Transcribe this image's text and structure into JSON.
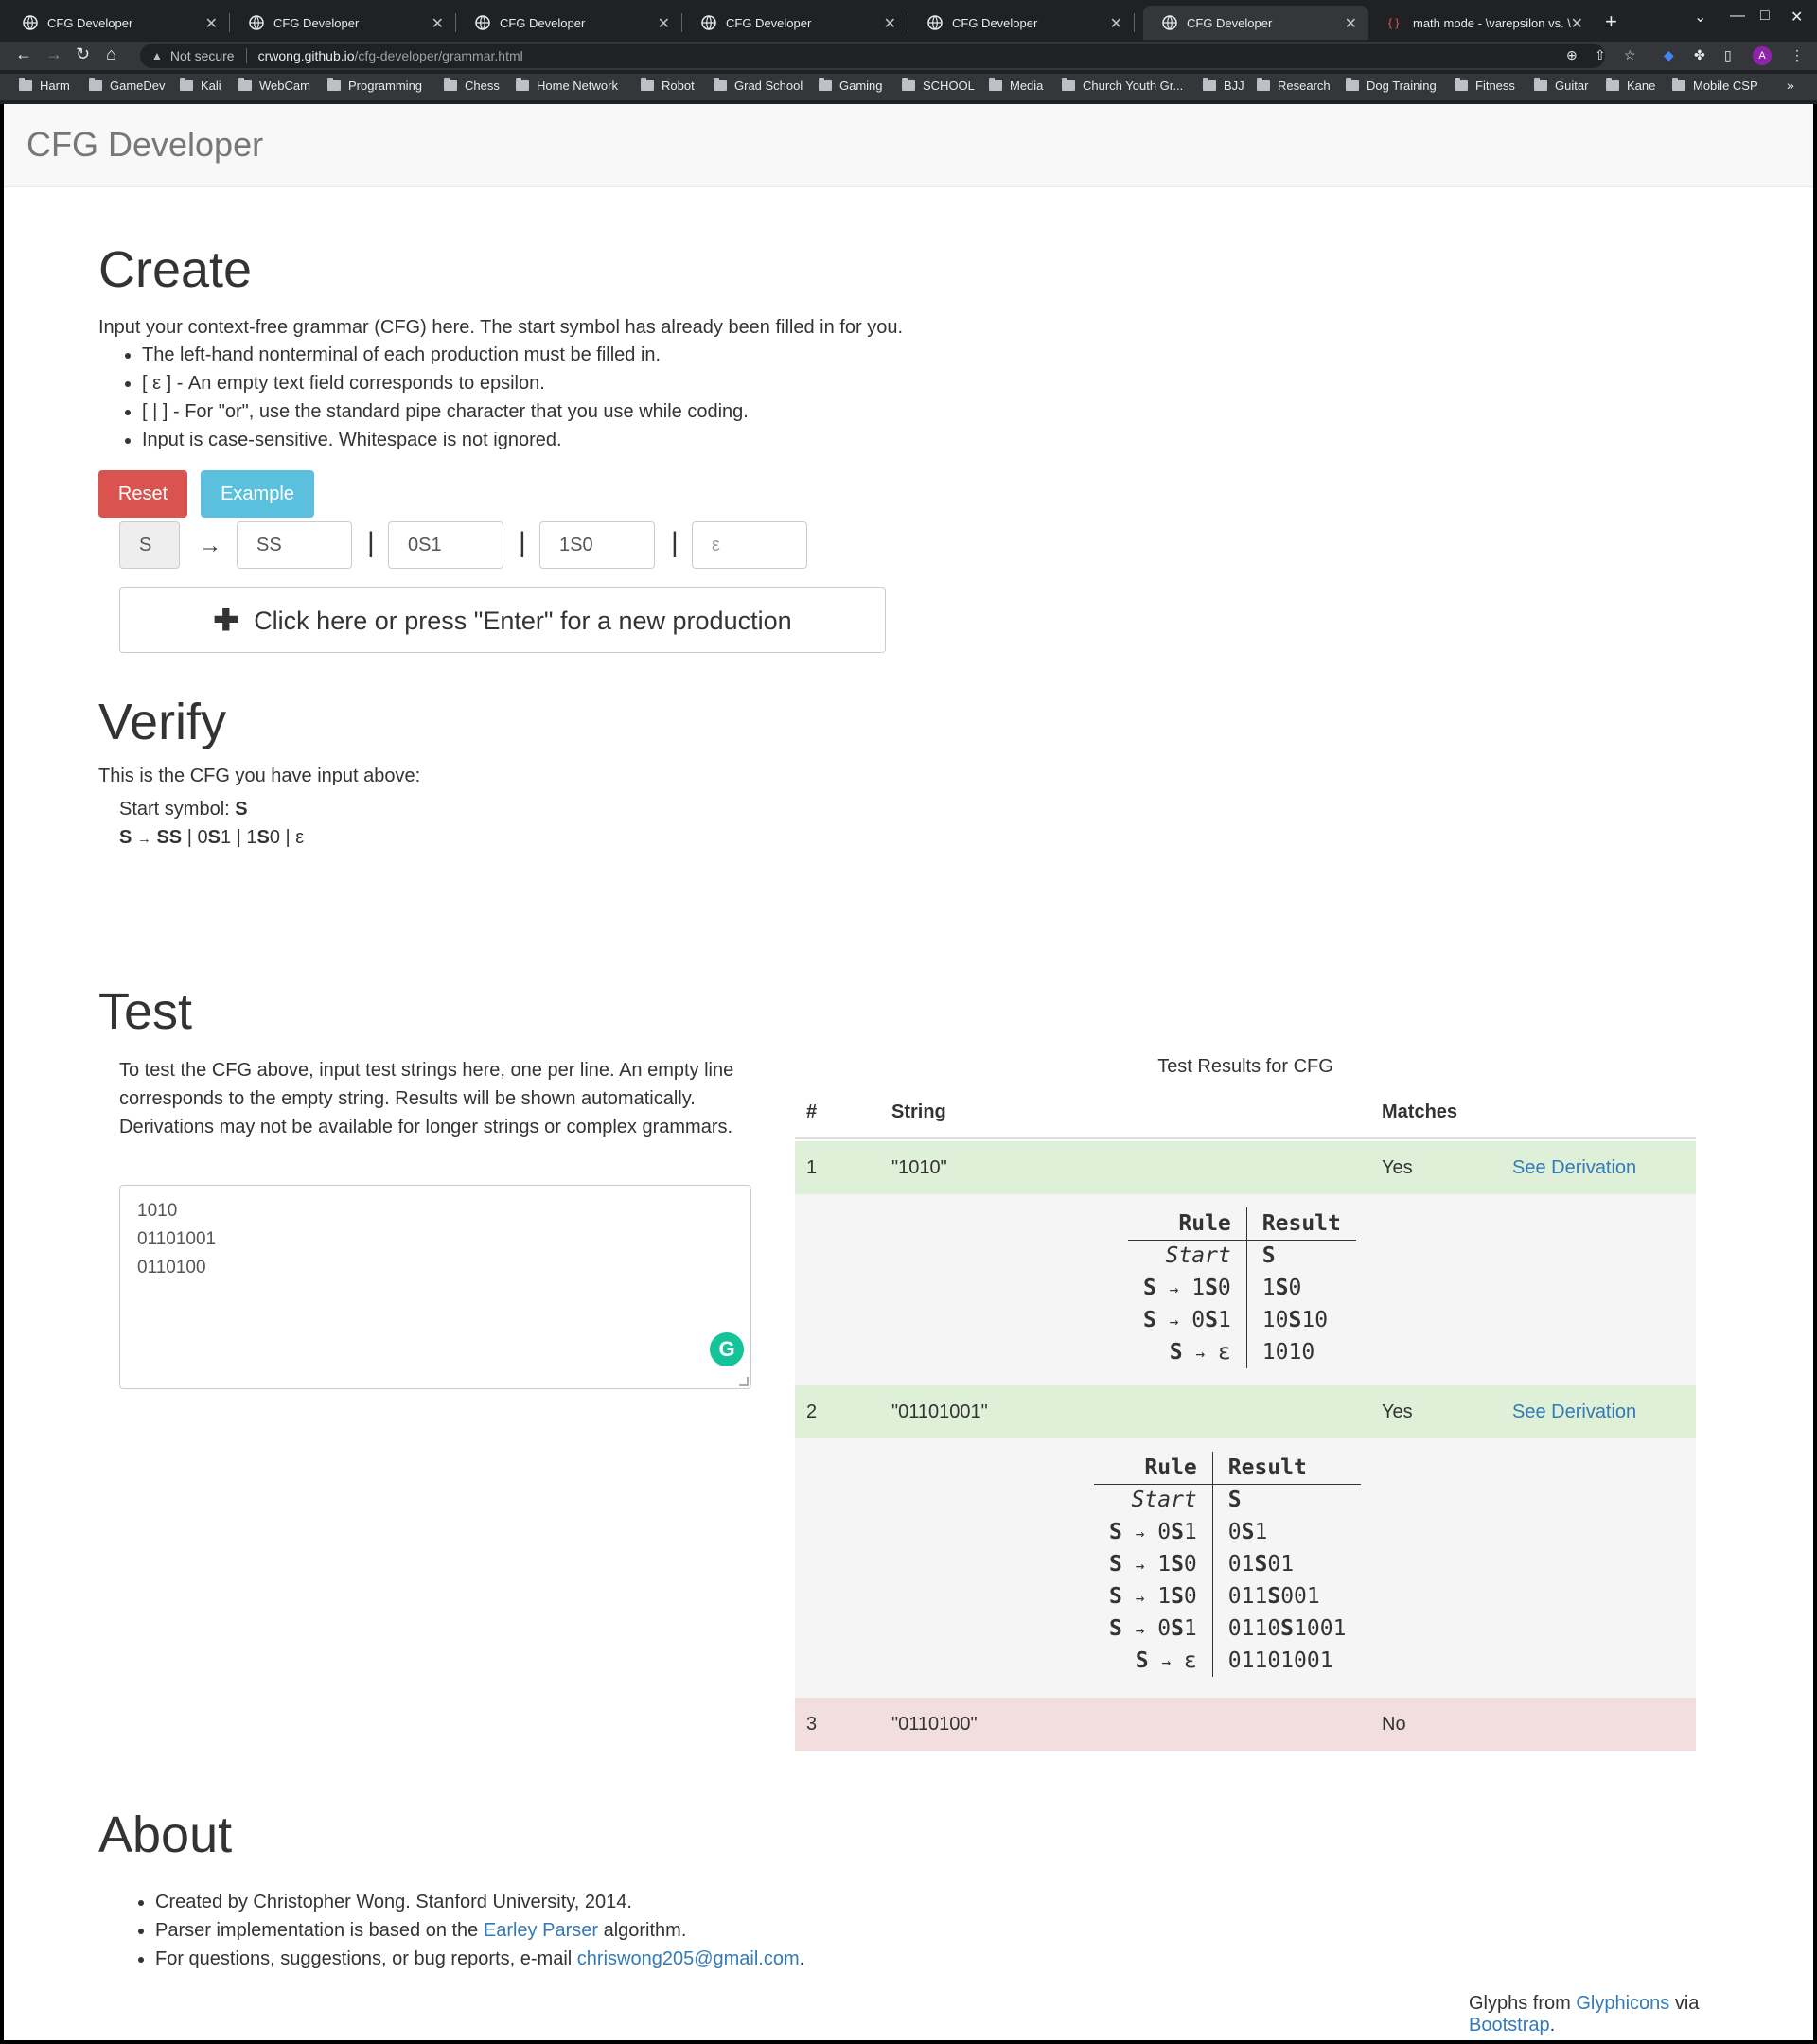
{
  "browser": {
    "tabs": [
      {
        "title": "CFG Developer"
      },
      {
        "title": "CFG Developer"
      },
      {
        "title": "CFG Developer"
      },
      {
        "title": "CFG Developer"
      },
      {
        "title": "CFG Developer"
      },
      {
        "title": "CFG Developer"
      },
      {
        "title": "math mode - \\varepsilon vs. \\"
      }
    ],
    "active_tab": 5,
    "security_label": "Not secure",
    "url_domain": "crwong.github.io",
    "url_path": "/cfg-developer/grammar.html",
    "profile_initial": "A",
    "bookmarks": [
      "Harm",
      "GameDev",
      "Kali",
      "WebCam",
      "Programming",
      "Chess",
      "Home Network",
      "Robot",
      "Grad School",
      "Gaming",
      "SCHOOL",
      "Media",
      "Church Youth Gr...",
      "BJJ",
      "Research",
      "Dog Training",
      "Fitness",
      "Guitar",
      "Kane",
      "Mobile CSP"
    ]
  },
  "navbar": {
    "brand": "CFG Developer"
  },
  "create": {
    "heading": "Create",
    "intro": "Input your context-free grammar (CFG) here. The start symbol has already been filled in for you.",
    "bullets": [
      "The left-hand nonterminal of each production must be filled in.",
      "[ ε ] - An empty text field corresponds to epsilon.",
      "[ | ] - For \"or\", use the standard pipe character that you use while coding.",
      "Input is case-sensitive. Whitespace is not ignored."
    ],
    "reset_label": "Reset",
    "example_label": "Example",
    "production": {
      "lhs": "S",
      "arrow": "→",
      "rhs": [
        "SS",
        "0S1",
        "1S0"
      ],
      "rhs_placeholder": "ε",
      "pipe": "|"
    },
    "new_production_label": "Click here or press \"Enter\" for a new production",
    "plus_icon": "✚"
  },
  "verify": {
    "heading": "Verify",
    "intro": "This is the CFG you have input above:",
    "start_label": "Start symbol:",
    "start_symbol": "S"
  },
  "test": {
    "heading": "Test",
    "help": "To test the CFG above, input test strings here, one per line. An empty line corresponds to the empty string. Results will be shown automatically. Derivations may not be available for longer strings or complex grammars.",
    "input_lines": [
      "1010",
      "01101001",
      "0110100"
    ],
    "results_caption": "Test Results for CFG",
    "columns": {
      "num": "#",
      "string": "String",
      "matches": "Matches"
    },
    "derivation_link": "See Derivation",
    "deriv_headers": {
      "rule": "Rule",
      "result": "Result"
    },
    "start_label": "Start",
    "rows": [
      {
        "num": "1",
        "string": "\"1010\"",
        "matches": "Yes"
      },
      {
        "num": "2",
        "string": "\"01101001\"",
        "matches": "Yes"
      },
      {
        "num": "3",
        "string": "\"0110100\"",
        "matches": "No"
      }
    ]
  },
  "about": {
    "heading": "About",
    "line1": "Created by Christopher Wong. Stanford University, 2014.",
    "line2_pre": "Parser implementation is based on the ",
    "line2_link": "Earley Parser",
    "line2_post": " algorithm.",
    "line3_pre": "For questions, suggestions, or bug reports, e-mail ",
    "line3_link": "chriswong205@gmail.com",
    "line3_post": "."
  },
  "footer": {
    "pre": "Glyphs from ",
    "link1": "Glyphicons",
    "mid": " via ",
    "link2": "Bootstrap",
    "post": "."
  }
}
